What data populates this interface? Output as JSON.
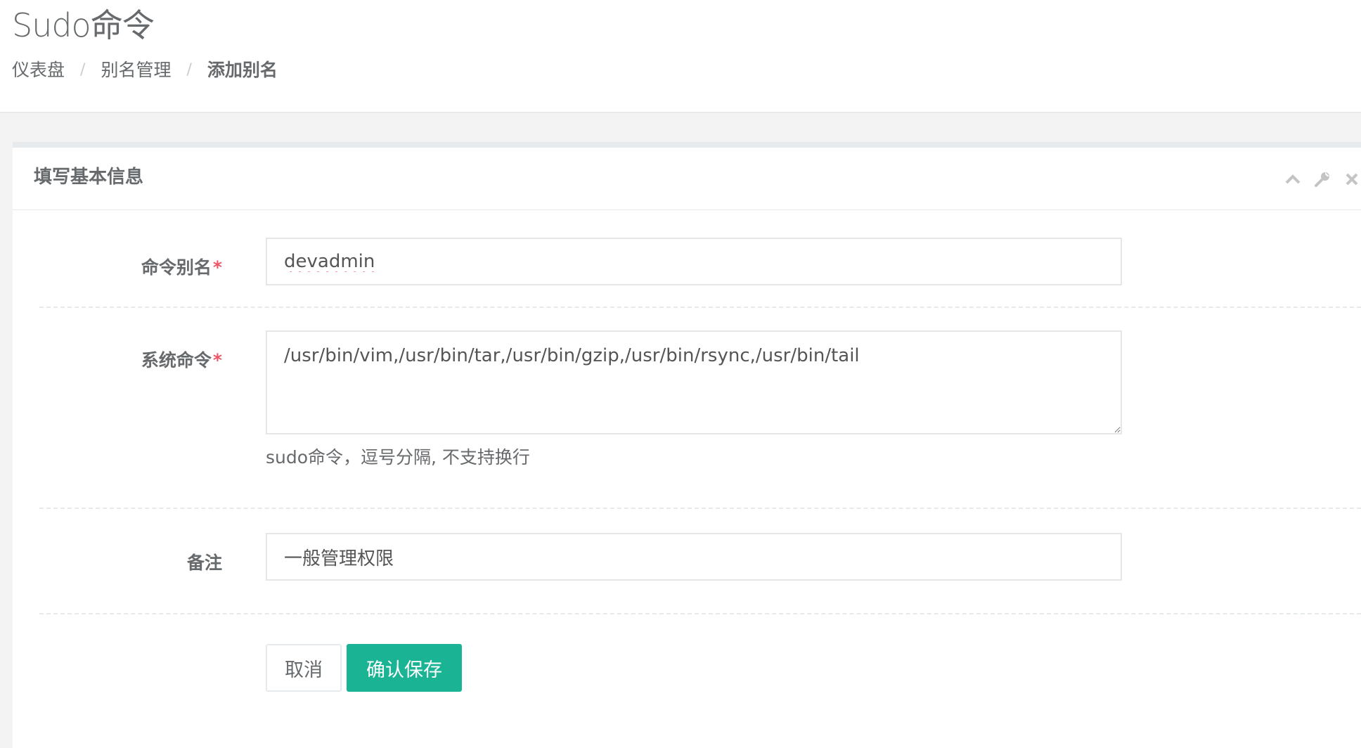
{
  "page": {
    "title": "Sudo命令"
  },
  "breadcrumb": {
    "items": [
      {
        "label": "仪表盘"
      },
      {
        "label": "别名管理"
      },
      {
        "label": "添加别名"
      }
    ],
    "separator": "/"
  },
  "panel": {
    "title": "填写基本信息",
    "tools": [
      "chevron-up-icon",
      "wrench-icon",
      "close-icon"
    ]
  },
  "form": {
    "alias": {
      "label": "命令别名",
      "required_mark": "*",
      "value": "devadmin"
    },
    "commands": {
      "label": "系统命令",
      "required_mark": "*",
      "value": "/usr/bin/vim,/usr/bin/tar,/usr/bin/gzip,/usr/bin/rsync,/usr/bin/tail",
      "help": "sudo命令，逗号分隔, 不支持换行"
    },
    "comment": {
      "label": "备注",
      "value": "一般管理权限"
    }
  },
  "buttons": {
    "cancel": "取消",
    "save": "确认保存"
  },
  "colors": {
    "primary": "#1ab394",
    "required": "#ed5565",
    "text": "#676a6c"
  }
}
